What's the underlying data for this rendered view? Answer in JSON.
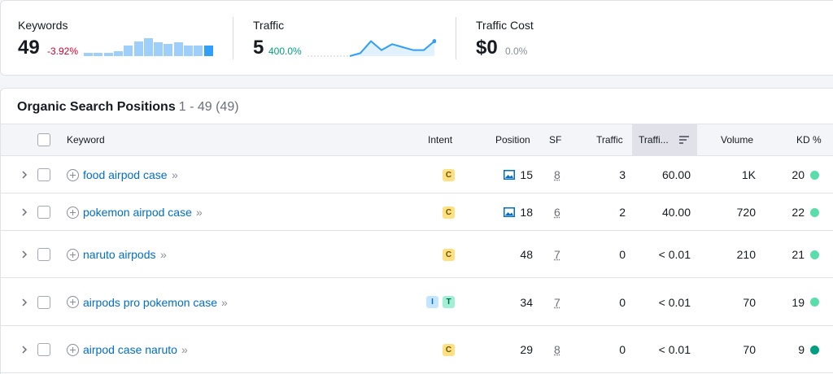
{
  "stats": {
    "keywords": {
      "title": "Keywords",
      "value": "49",
      "change": "-3.92%",
      "change_color": "#d1002f"
    },
    "traffic": {
      "title": "Traffic",
      "value": "5",
      "change": "400.0%",
      "change_color": "#009f81"
    },
    "traffic_cost": {
      "title": "Traffic Cost",
      "value": "$0",
      "change": "0.0%",
      "change_color": "#8a8d99"
    }
  },
  "chart_data": [
    {
      "type": "bar",
      "series": [
        {
          "values": [
            0.2,
            0.2,
            0.2,
            0.3,
            0.7,
            1.0,
            1.2,
            0.9,
            0.8,
            0.9,
            0.7,
            0.7,
            0.7
          ]
        }
      ],
      "ylim": [
        0,
        1.3
      ],
      "colors": {
        "bar": "#9ecffb",
        "last_bar": "#2f9ff8"
      }
    },
    {
      "type": "area",
      "series": [
        {
          "values": [
            0,
            0,
            0,
            0,
            0,
            1,
            5,
            2,
            4,
            3,
            2,
            2,
            5
          ]
        }
      ],
      "ylim": [
        0,
        6
      ],
      "colors": {
        "line": "#2f9ff8",
        "fill": "#e1f1fe"
      }
    }
  ],
  "table": {
    "title": "Organic Search Positions",
    "range": "1 - 49 (49)",
    "headers": {
      "keyword": "Keyword",
      "intent": "Intent",
      "position": "Position",
      "sf": "SF",
      "traffic": "Traffic",
      "traffic_pct": "Traffi...",
      "volume": "Volume",
      "kd": "KD %"
    },
    "rows": [
      {
        "keyword": "food airpod case",
        "intents": [
          "C"
        ],
        "image_icon": true,
        "position": "15",
        "sf": "8",
        "traffic": "3",
        "traffic_pct": "60.00",
        "volume": "1K",
        "kd": "20",
        "kd_color": "#59ddaa"
      },
      {
        "keyword": "pokemon airpod case",
        "intents": [
          "C"
        ],
        "image_icon": true,
        "position": "18",
        "sf": "6",
        "traffic": "2",
        "traffic_pct": "40.00",
        "volume": "720",
        "kd": "22",
        "kd_color": "#59ddaa"
      },
      {
        "keyword": "naruto airpods",
        "intents": [
          "C"
        ],
        "image_icon": false,
        "position": "48",
        "sf": "7",
        "traffic": "0",
        "traffic_pct": "< 0.01",
        "volume": "210",
        "kd": "21",
        "kd_color": "#59ddaa"
      },
      {
        "keyword": "airpods pro pokemon case",
        "intents": [
          "I",
          "T"
        ],
        "image_icon": false,
        "position": "34",
        "sf": "7",
        "traffic": "0",
        "traffic_pct": "< 0.01",
        "volume": "70",
        "kd": "19",
        "kd_color": "#59ddaa"
      },
      {
        "keyword": "airpod case naruto",
        "intents": [
          "C"
        ],
        "image_icon": false,
        "position": "29",
        "sf": "8",
        "traffic": "0",
        "traffic_pct": "< 0.01",
        "volume": "70",
        "kd": "9",
        "kd_color": "#009f81"
      }
    ]
  },
  "colors": {
    "link": "#006dca",
    "header_bg": "#f4f5f9",
    "active_header_bg": "#e0e1e9"
  }
}
